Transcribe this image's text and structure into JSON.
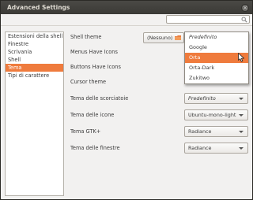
{
  "window": {
    "title": "Advanced Settings"
  },
  "search": {
    "value": "",
    "placeholder": ""
  },
  "sidebar": {
    "items": [
      {
        "label": "Estensioni della shell",
        "selected": false
      },
      {
        "label": "Finestre",
        "selected": false
      },
      {
        "label": "Scrivania",
        "selected": false
      },
      {
        "label": "Shell",
        "selected": false
      },
      {
        "label": "Tema",
        "selected": true
      },
      {
        "label": "Tipi di carattere",
        "selected": false
      }
    ]
  },
  "settings": {
    "shell_theme": {
      "label": "Shell theme",
      "button_label": "(Nessuno)"
    },
    "menus_have_icons": {
      "label": "Menus Have Icons"
    },
    "buttons_have_icons": {
      "label": "Buttons Have Icons"
    },
    "cursor_theme": {
      "label": "Cursor theme"
    },
    "shortcut_theme": {
      "label": "Tema delle scorciatoie",
      "value": "Predefinito"
    },
    "icon_theme": {
      "label": "Tema delle icone",
      "value": "Ubuntu-mono-light"
    },
    "gtk_theme": {
      "label": "Tema GTK+",
      "value": "Radiance"
    },
    "window_theme": {
      "label": "Tema delle finestre",
      "value": "Radiance"
    }
  },
  "dropdown": {
    "options": [
      {
        "label": "Predefinito",
        "italic": true,
        "selected": false
      },
      {
        "label": "Google",
        "italic": false,
        "selected": false
      },
      {
        "label": "Orta",
        "italic": false,
        "selected": true
      },
      {
        "label": "Orta-Dark",
        "italic": false,
        "selected": false
      },
      {
        "label": "Zukitwo",
        "italic": false,
        "selected": false
      }
    ]
  },
  "colors": {
    "accent": "#ef7b3d",
    "window_bg": "#f2f1f0",
    "titlebar": "#3c3b37"
  }
}
